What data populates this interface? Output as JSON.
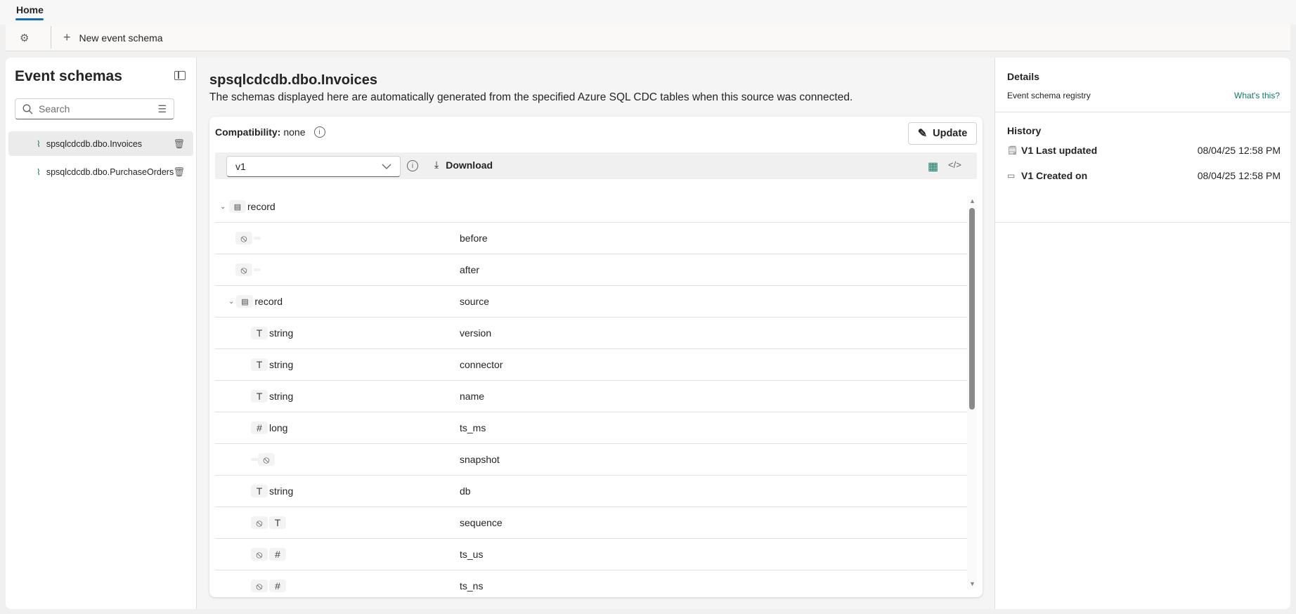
{
  "tabs": [
    {
      "label": "Home",
      "active": true
    }
  ],
  "toolbar": {
    "settings_icon": "gear-icon",
    "new_label": "New event schema"
  },
  "sidebar": {
    "title": "Event schemas",
    "search_placeholder": "Search",
    "items": [
      {
        "label": "spsqlcdcdb.dbo.Invoices",
        "selected": true
      },
      {
        "label": "spsqlcdcdb.dbo.PurchaseOrders",
        "selected": false
      }
    ]
  },
  "main": {
    "title": "spsqlcdcdb.dbo.Invoices",
    "description": "The schemas displayed here are automatically generated from the specified Azure SQL CDC tables when this source was connected.",
    "compat_label": "Compatibility:",
    "compat_value": "none",
    "update_label": "Update",
    "version": "v1",
    "download_label": "Download",
    "root": {
      "type": "record"
    },
    "rows": [
      {
        "level": 1,
        "badges": [
          "null"
        ],
        "dash": "after",
        "type": "",
        "name": "before"
      },
      {
        "level": 1,
        "badges": [
          "null"
        ],
        "dash": "after",
        "type": "",
        "name": "after"
      },
      {
        "level": 1,
        "badges": [
          "record"
        ],
        "chevron": true,
        "type": "record",
        "name": "source"
      },
      {
        "level": 2,
        "badges": [
          "T"
        ],
        "type": "string",
        "name": "version"
      },
      {
        "level": 2,
        "badges": [
          "T"
        ],
        "type": "string",
        "name": "connector"
      },
      {
        "level": 2,
        "badges": [
          "T"
        ],
        "type": "string",
        "name": "name"
      },
      {
        "level": 2,
        "badges": [
          "#"
        ],
        "type": "long",
        "name": "ts_ms"
      },
      {
        "level": 2,
        "badges": [
          "null"
        ],
        "dash": "before",
        "type": "",
        "name": "snapshot"
      },
      {
        "level": 2,
        "badges": [
          "T"
        ],
        "type": "string",
        "name": "db"
      },
      {
        "level": 2,
        "badges": [
          "null",
          "T"
        ],
        "type": "",
        "name": "sequence"
      },
      {
        "level": 2,
        "badges": [
          "null",
          "#"
        ],
        "type": "",
        "name": "ts_us"
      },
      {
        "level": 2,
        "badges": [
          "null",
          "#"
        ],
        "type": "",
        "name": "ts_ns"
      }
    ]
  },
  "details": {
    "title": "Details",
    "registry": "Event schema registry",
    "whats_this": "What's this?",
    "history_title": "History",
    "history": [
      {
        "label": "V1 Last updated",
        "date": "08/04/25 12:58 PM",
        "icon": "edit-document-icon"
      },
      {
        "label": "V1 Created on",
        "date": "08/04/25 12:58 PM",
        "icon": "calendar-icon"
      }
    ]
  },
  "colors": {
    "accent": "#0f6cbd",
    "teal": "#117865",
    "link": "#0e7a6c"
  }
}
